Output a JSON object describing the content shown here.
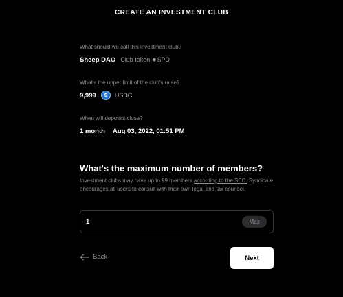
{
  "header": {
    "title": "CREATE AN INVESTMENT CLUB"
  },
  "summary": {
    "name": {
      "question": "What should we call this investment club?",
      "club_name": "Sheep DAO",
      "token_label": "Club token",
      "token_symbol_glyph": "✺",
      "token_symbol": "SPD"
    },
    "raise": {
      "question": "What's the upper limit of the club's raise?",
      "amount": "9,999",
      "currency_icon": "usdc-icon",
      "currency_icon_glyph": "$",
      "currency": "USDC"
    },
    "close": {
      "question": "When will deposits close?",
      "duration": "1 month",
      "date": "Aug 03, 2022, 01:51 PM"
    }
  },
  "members": {
    "question": "What's the maximum number of members?",
    "helper_prefix": "Investment clubs may have up to 99 members ",
    "helper_link": "according to the SEC.",
    "helper_suffix": " Syndicate encourages all users to consult with their own legal and tax counsel.",
    "value": "1",
    "max_label": "Max"
  },
  "footer": {
    "back_label": "Back",
    "next_label": "Next"
  },
  "colors": {
    "background": "#000000",
    "muted_text": "#8e8e93",
    "usdc_blue": "#2775ca",
    "primary_button": "#ffffff"
  }
}
